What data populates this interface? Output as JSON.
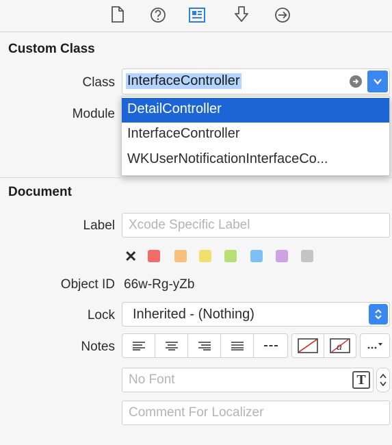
{
  "toolbar": {
    "icons": [
      "file-inspector-icon",
      "quick-help-icon",
      "identity-inspector-icon",
      "attributes-inspector-icon",
      "connections-inspector-icon"
    ]
  },
  "custom_class": {
    "title": "Custom Class",
    "class_label": "Class",
    "class_value": "InterfaceController",
    "module_label": "Module",
    "options": [
      {
        "label": "DetailController",
        "selected": true
      },
      {
        "label": "InterfaceController",
        "selected": false
      },
      {
        "label": "WKUserNotificationInterfaceCo...",
        "selected": false
      }
    ]
  },
  "document": {
    "title": "Document",
    "label_label": "Label",
    "label_placeholder": "Xcode Specific Label",
    "color_labels": [
      "#f26b6b",
      "#f8c07a",
      "#f3df6b",
      "#b7df72",
      "#7fc0f4",
      "#cfa2e6",
      "#c4c4c4"
    ],
    "object_id_label": "Object ID",
    "object_id_value": "66w-Rg-yZb",
    "lock_label": "Lock",
    "lock_value": "Inherited - (Nothing)",
    "notes_label": "Notes",
    "font_placeholder": "No Font",
    "comment_placeholder": "Comment For Localizer"
  },
  "colors": {
    "accent": "#3b87f0",
    "selection": "#1b65d7",
    "text_highlight": "#b3d4fc"
  }
}
